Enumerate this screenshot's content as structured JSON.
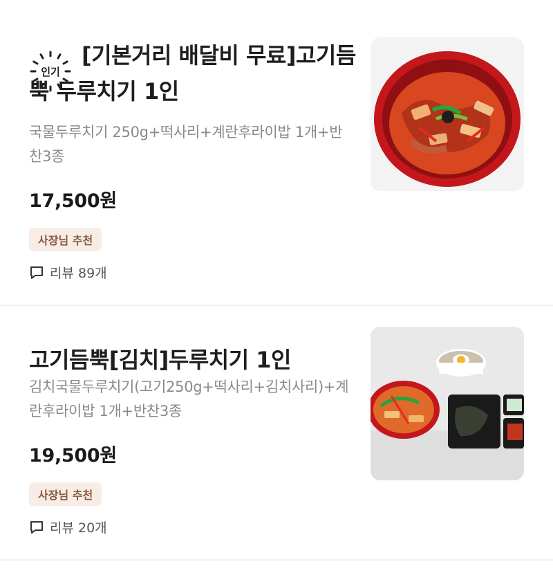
{
  "items": [
    {
      "badge": "인기",
      "title": "[기본거리 배달비 무료]고기듬뿍 두루치기 1인",
      "description": "국물두루치기 250g+떡사리+계란후라이밥 1개+반찬3종",
      "price": "17,500원",
      "tag": "사장님 추천",
      "review": "리뷰 89개",
      "image_icon": "food-photo-icon"
    },
    {
      "title": "고기듬뿍[김치]두루치기 1인",
      "description": "김치국물두루치기(고기250g+떡사리+김치사리)+계란후라이밥 1개+반찬3종",
      "price": "19,500원",
      "tag": "사장님 추천",
      "review": "리뷰 20개",
      "image_icon": "food-photo-icon"
    }
  ],
  "colors": {
    "tag_bg": "#f7ede6",
    "tag_text": "#8b5a3c",
    "desc_text": "#8a8a8a",
    "divider": "#f1f1f1"
  }
}
